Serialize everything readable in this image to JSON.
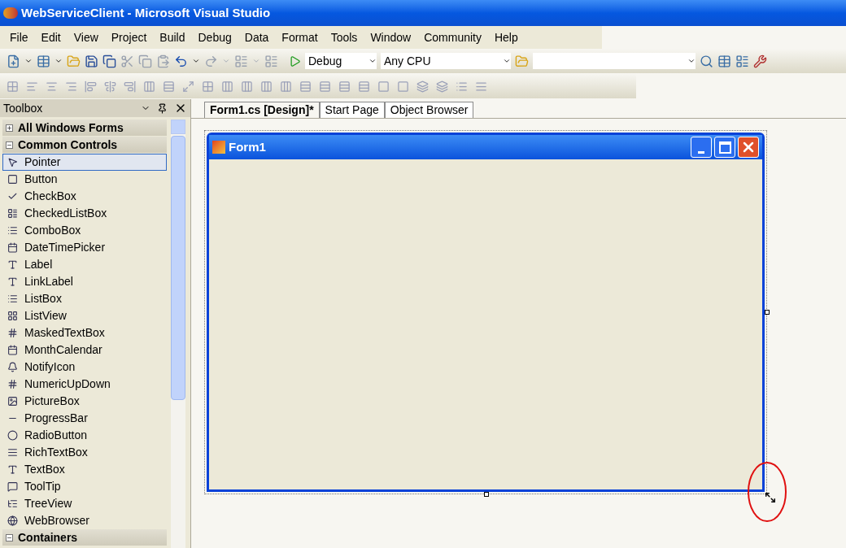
{
  "window": {
    "title": "WebServiceClient - Microsoft Visual Studio"
  },
  "menu": [
    "File",
    "Edit",
    "View",
    "Project",
    "Build",
    "Debug",
    "Data",
    "Format",
    "Tools",
    "Window",
    "Community",
    "Help"
  ],
  "toolbar": {
    "configuration": "Debug",
    "platform": "Any CPU"
  },
  "toolbox": {
    "title": "Toolbox",
    "groups": [
      {
        "label": "All Windows Forms",
        "expanded": false
      },
      {
        "label": "Common Controls",
        "expanded": true,
        "items": [
          {
            "label": "Pointer",
            "selected": true
          },
          {
            "label": "Button",
            "selected": false
          },
          {
            "label": "CheckBox",
            "selected": false
          },
          {
            "label": "CheckedListBox",
            "selected": false
          },
          {
            "label": "ComboBox",
            "selected": false
          },
          {
            "label": "DateTimePicker",
            "selected": false
          },
          {
            "label": "Label",
            "selected": false
          },
          {
            "label": "LinkLabel",
            "selected": false
          },
          {
            "label": "ListBox",
            "selected": false
          },
          {
            "label": "ListView",
            "selected": false
          },
          {
            "label": "MaskedTextBox",
            "selected": false
          },
          {
            "label": "MonthCalendar",
            "selected": false
          },
          {
            "label": "NotifyIcon",
            "selected": false
          },
          {
            "label": "NumericUpDown",
            "selected": false
          },
          {
            "label": "PictureBox",
            "selected": false
          },
          {
            "label": "ProgressBar",
            "selected": false
          },
          {
            "label": "RadioButton",
            "selected": false
          },
          {
            "label": "RichTextBox",
            "selected": false
          },
          {
            "label": "TextBox",
            "selected": false
          },
          {
            "label": "ToolTip",
            "selected": false
          },
          {
            "label": "TreeView",
            "selected": false
          },
          {
            "label": "WebBrowser",
            "selected": false
          }
        ]
      },
      {
        "label": "Containers",
        "expanded": true
      }
    ]
  },
  "tabs": [
    {
      "label": "Form1.cs [Design]*",
      "selected": true
    },
    {
      "label": "Start Page",
      "selected": false
    },
    {
      "label": "Object Browser",
      "selected": false
    }
  ],
  "form": {
    "title": "Form1"
  }
}
